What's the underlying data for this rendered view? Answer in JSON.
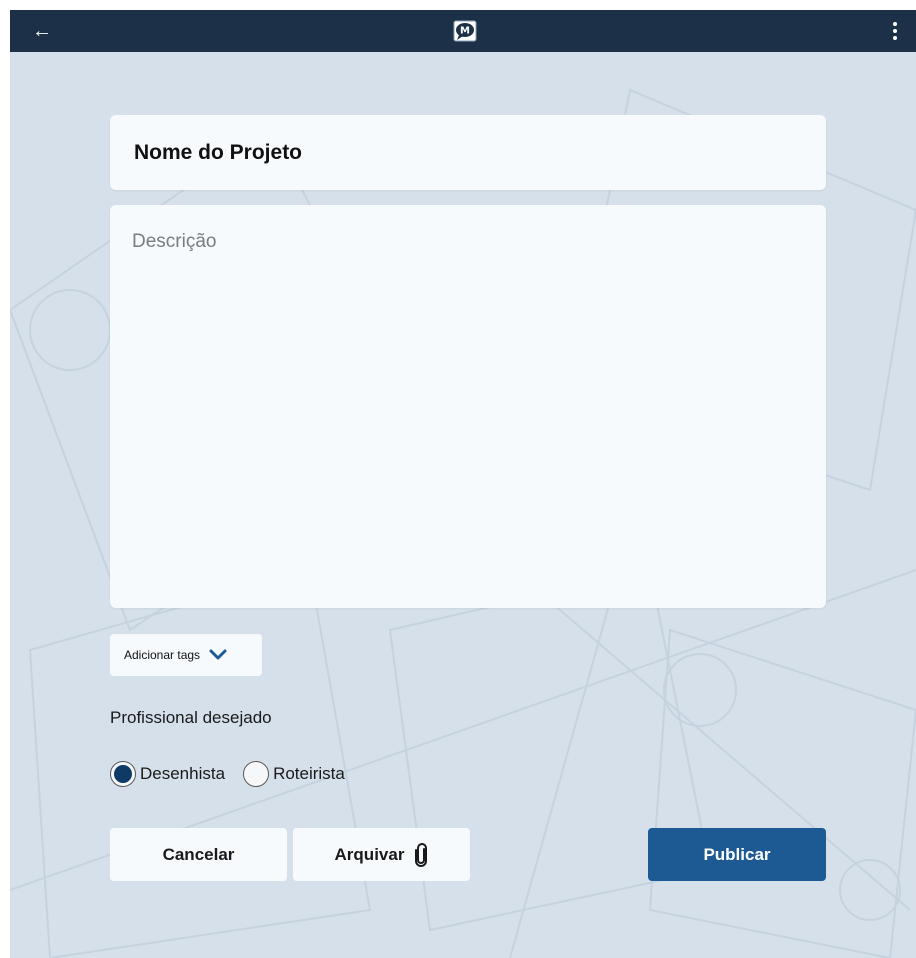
{
  "appbar": {
    "back_icon": "arrow-left-icon",
    "logo_icon": "speech-bubble-logo-icon",
    "menu_icon": "more-vert-icon"
  },
  "form": {
    "title_placeholder": "Nome do Projeto",
    "description_placeholder": "Descrição",
    "tags_label": "Adicionar tags",
    "professional_label": "Profissional desejado",
    "options": [
      "Desenhista",
      "Roteirista"
    ],
    "selected_option": "Desenhista"
  },
  "actions": {
    "cancel_label": "Cancelar",
    "archive_label": "Arquivar",
    "publish_label": "Publicar"
  },
  "colors": {
    "appbar": "#1c3148",
    "background": "#d6e0ea",
    "card": "#f7fafd",
    "primary": "#1d5a94",
    "radio_selected": "#0f3a66"
  }
}
